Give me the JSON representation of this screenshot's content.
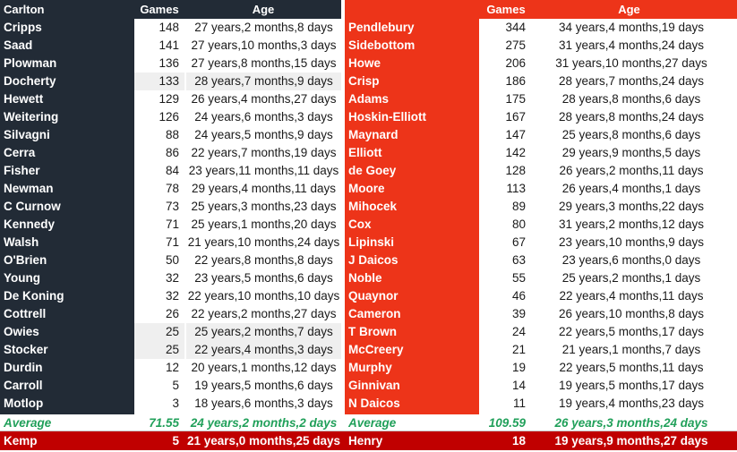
{
  "colors": {
    "left_team": "#222b36",
    "right_team": "#ed3419",
    "average_text": "#21a05a",
    "highlight_row": "#c00000",
    "body_text": "#1a1a1a",
    "page_bg": "#ffffff"
  },
  "headers": {
    "left_team_name": "Carlton",
    "right_team_name": "",
    "games": "Games",
    "age": "Age"
  },
  "left": {
    "rows": [
      {
        "name": "Cripps",
        "games": "148",
        "age": "27 years,2 months,8 days",
        "shade": false
      },
      {
        "name": "Saad",
        "games": "141",
        "age": "27 years,10 months,3 days",
        "shade": false
      },
      {
        "name": "Plowman",
        "games": "136",
        "age": "27 years,8 months,15 days",
        "shade": false
      },
      {
        "name": "Docherty",
        "games": "133",
        "age": "28 years,7 months,9 days",
        "shade": true
      },
      {
        "name": "Hewett",
        "games": "129",
        "age": "26 years,4 months,27 days",
        "shade": false
      },
      {
        "name": "Weitering",
        "games": "126",
        "age": "24 years,6 months,3 days",
        "shade": false
      },
      {
        "name": "Silvagni",
        "games": "88",
        "age": "24 years,5 months,9 days",
        "shade": false
      },
      {
        "name": "Cerra",
        "games": "86",
        "age": "22 years,7 months,19 days",
        "shade": false
      },
      {
        "name": "Fisher",
        "games": "84",
        "age": "23 years,11 months,11 days",
        "shade": false
      },
      {
        "name": "Newman",
        "games": "78",
        "age": "29 years,4 months,11 days",
        "shade": false
      },
      {
        "name": "C Curnow",
        "games": "73",
        "age": "25 years,3 months,23 days",
        "shade": false
      },
      {
        "name": "Kennedy",
        "games": "71",
        "age": "25 years,1 months,20 days",
        "shade": false
      },
      {
        "name": "Walsh",
        "games": "71",
        "age": "21 years,10 months,24 days",
        "shade": false
      },
      {
        "name": "O'Brien",
        "games": "50",
        "age": "22 years,8 months,8 days",
        "shade": false
      },
      {
        "name": "Young",
        "games": "32",
        "age": "23 years,5 months,6 days",
        "shade": false
      },
      {
        "name": "De Koning",
        "games": "32",
        "age": "22 years,10 months,10 days",
        "shade": false
      },
      {
        "name": "Cottrell",
        "games": "26",
        "age": "22 years,2 months,27 days",
        "shade": false
      },
      {
        "name": "Owies",
        "games": "25",
        "age": "25 years,2 months,7 days",
        "shade": true
      },
      {
        "name": "Stocker",
        "games": "25",
        "age": "22 years,4 months,3 days",
        "shade": true
      },
      {
        "name": "Durdin",
        "games": "12",
        "age": "20 years,1 months,12 days",
        "shade": false
      },
      {
        "name": "Carroll",
        "games": "5",
        "age": "19 years,5 months,6 days",
        "shade": false
      },
      {
        "name": "Motlop",
        "games": "3",
        "age": "18 years,6 months,3 days",
        "shade": false
      }
    ],
    "average": {
      "label": "Average",
      "games": "71.55",
      "age": "24 years,2 months,2 days"
    },
    "highlight": {
      "name": "Kemp",
      "games": "5",
      "age": "21 years,0 months,25 days"
    }
  },
  "right": {
    "rows": [
      {
        "name": "Pendlebury",
        "games": "344",
        "age": "34 years,4 months,19 days"
      },
      {
        "name": "Sidebottom",
        "games": "275",
        "age": "31 years,4 months,24 days"
      },
      {
        "name": "Howe",
        "games": "206",
        "age": "31 years,10 months,27 days"
      },
      {
        "name": "Crisp",
        "games": "186",
        "age": "28 years,7 months,24 days"
      },
      {
        "name": "Adams",
        "games": "175",
        "age": "28 years,8 months,6 days"
      },
      {
        "name": "Hoskin-Elliott",
        "games": "167",
        "age": "28 years,8 months,24 days"
      },
      {
        "name": "Maynard",
        "games": "147",
        "age": "25 years,8 months,6 days"
      },
      {
        "name": "Elliott",
        "games": "142",
        "age": "29 years,9 months,5 days"
      },
      {
        "name": "de Goey",
        "games": "128",
        "age": "26 years,2 months,11 days"
      },
      {
        "name": "Moore",
        "games": "113",
        "age": "26 years,4 months,1 days"
      },
      {
        "name": "Mihocek",
        "games": "89",
        "age": "29 years,3 months,22 days"
      },
      {
        "name": "Cox",
        "games": "80",
        "age": "31 years,2 months,12 days"
      },
      {
        "name": "Lipinski",
        "games": "67",
        "age": "23 years,10 months,9 days"
      },
      {
        "name": "J Daicos",
        "games": "63",
        "age": "23 years,6 months,0 days"
      },
      {
        "name": "Noble",
        "games": "55",
        "age": "25 years,2 months,1 days"
      },
      {
        "name": "Quaynor",
        "games": "46",
        "age": "22 years,4 months,11 days"
      },
      {
        "name": "Cameron",
        "games": "39",
        "age": "26 years,10 months,8 days"
      },
      {
        "name": "T Brown",
        "games": "24",
        "age": "22 years,5 months,17 days"
      },
      {
        "name": "McCreery",
        "games": "21",
        "age": "21 years,1 months,7 days"
      },
      {
        "name": "Murphy",
        "games": "19",
        "age": "22 years,5 months,11 days"
      },
      {
        "name": "Ginnivan",
        "games": "14",
        "age": "19 years,5 months,17 days"
      },
      {
        "name": "N Daicos",
        "games": "11",
        "age": "19 years,4 months,23 days"
      }
    ],
    "average": {
      "label": "Average",
      "games": "109.59",
      "age": "26 years,3 months,24 days"
    },
    "highlight": {
      "name": "Henry",
      "games": "18",
      "age": "19 years,9 months,27 days"
    }
  }
}
